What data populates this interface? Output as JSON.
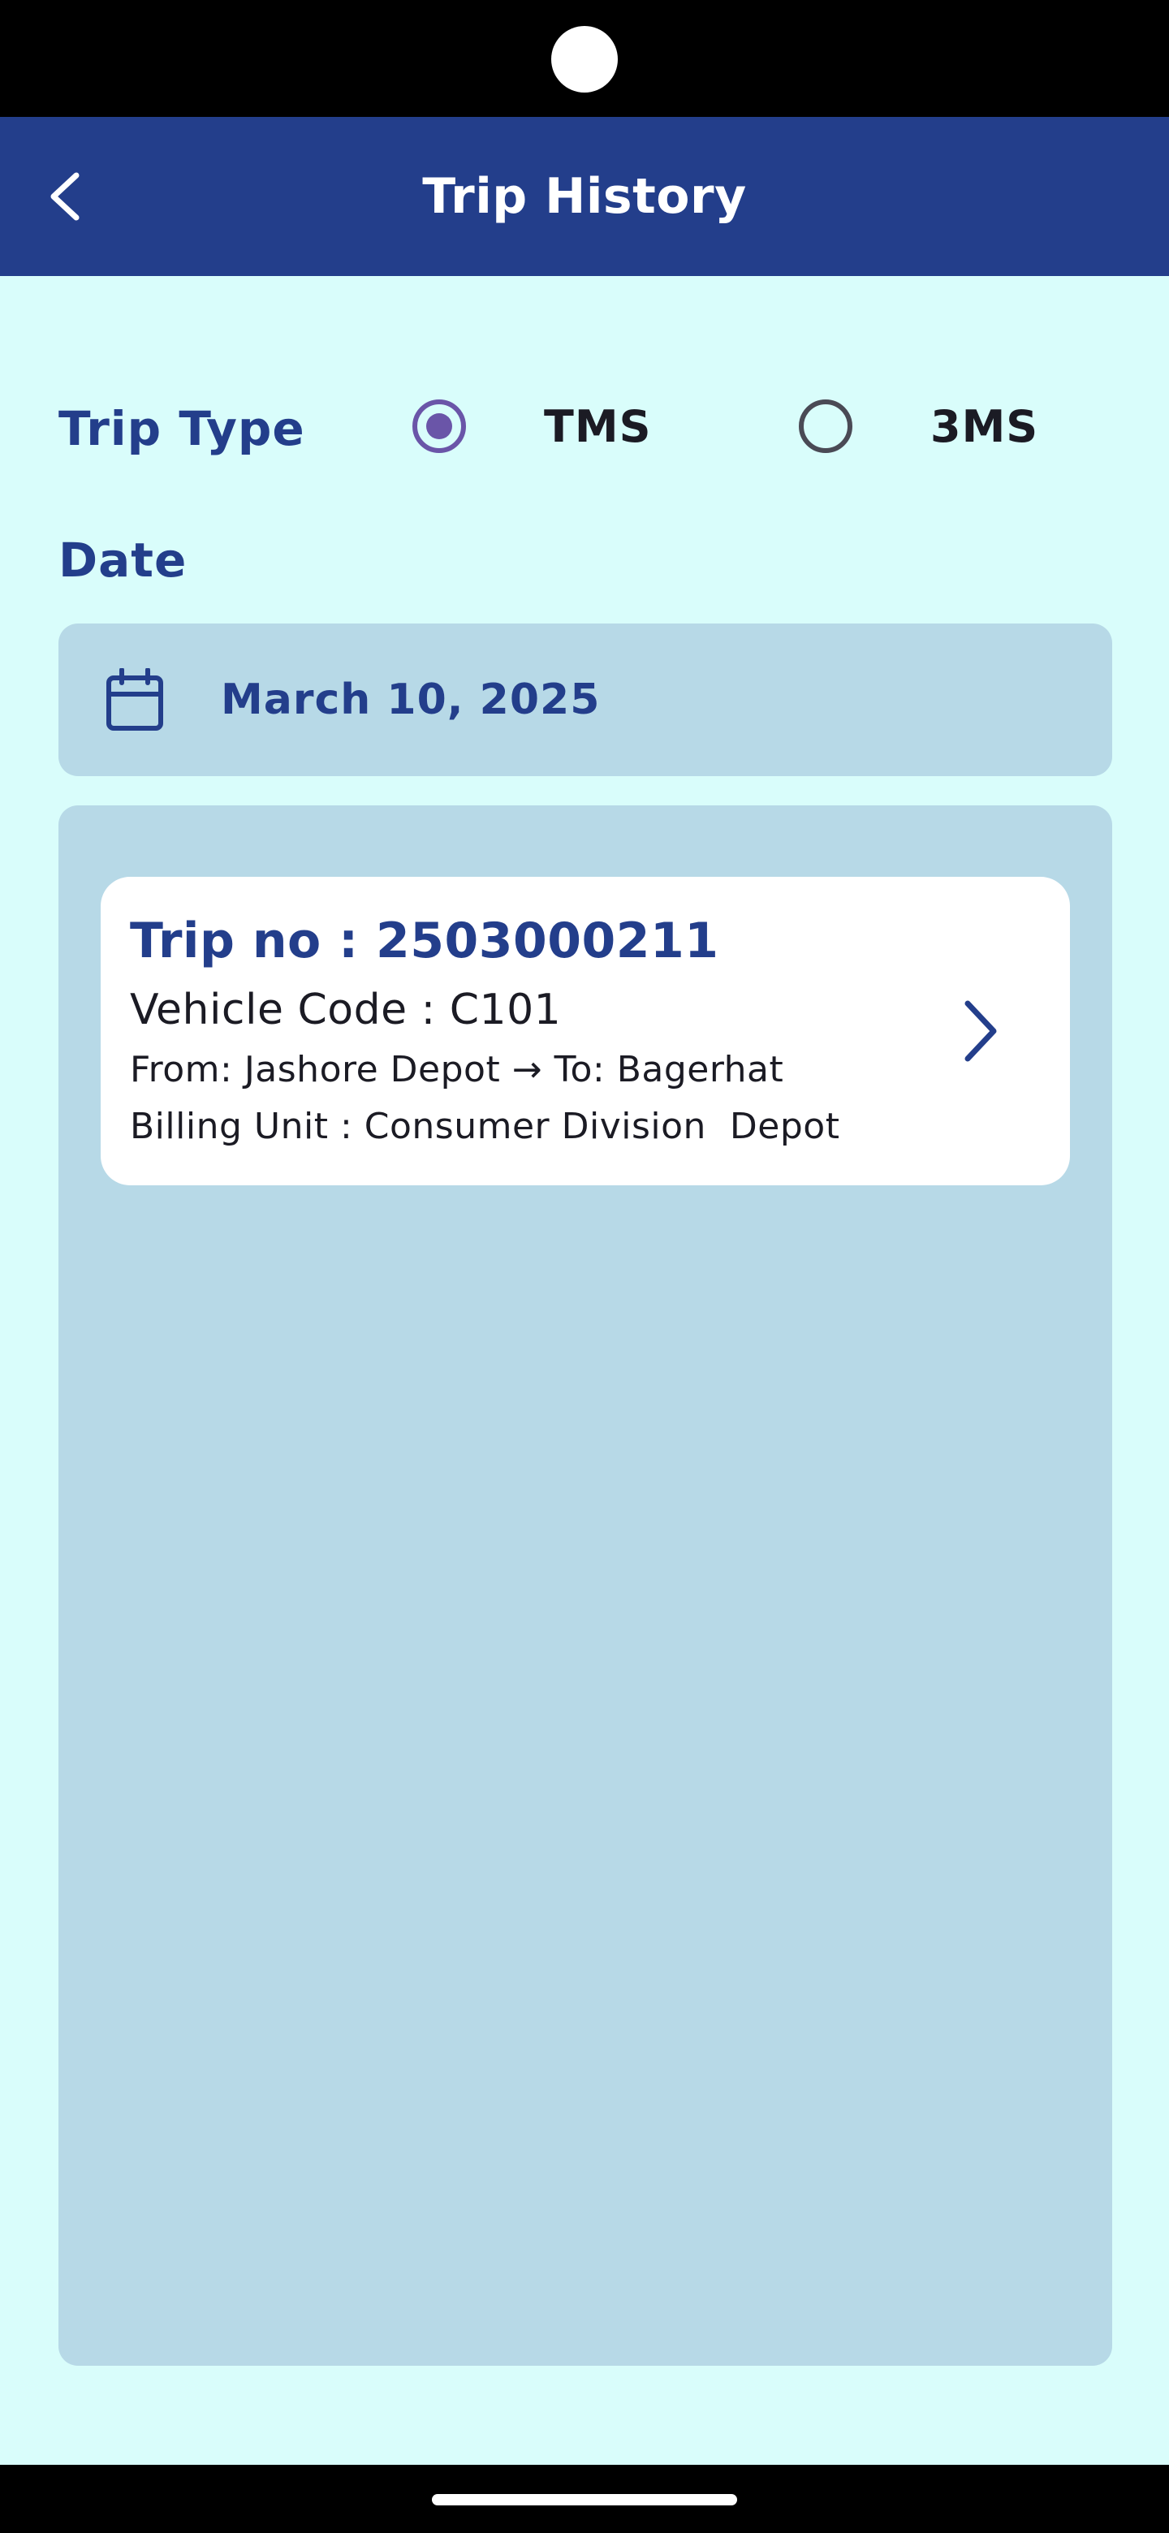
{
  "app_bar": {
    "title": "Trip History",
    "back_icon": "chevron-left-icon",
    "background": "#233e8b"
  },
  "filters": {
    "trip_type_label": "Trip Type",
    "options": [
      {
        "label": "TMS",
        "selected": true
      },
      {
        "label": "3MS",
        "selected": false
      }
    ],
    "date_label": "Date",
    "date_value": "March 10, 2025",
    "date_icon": "calendar-icon"
  },
  "trips": [
    {
      "trip_no": "Trip no : 2503000211",
      "vehicle_code": "Vehicle Code : C101",
      "route": "From: Jashore Depot → To: Bagerhat",
      "billing_unit": "Billing Unit : Consumer Division  Depot",
      "action_icon": "chevron-right-icon"
    }
  ],
  "colors": {
    "accent": "#233e8b",
    "radio_selected": "#6a55a8",
    "page_background": "#d9fdfb",
    "panel_background": "#b7d9e7"
  }
}
